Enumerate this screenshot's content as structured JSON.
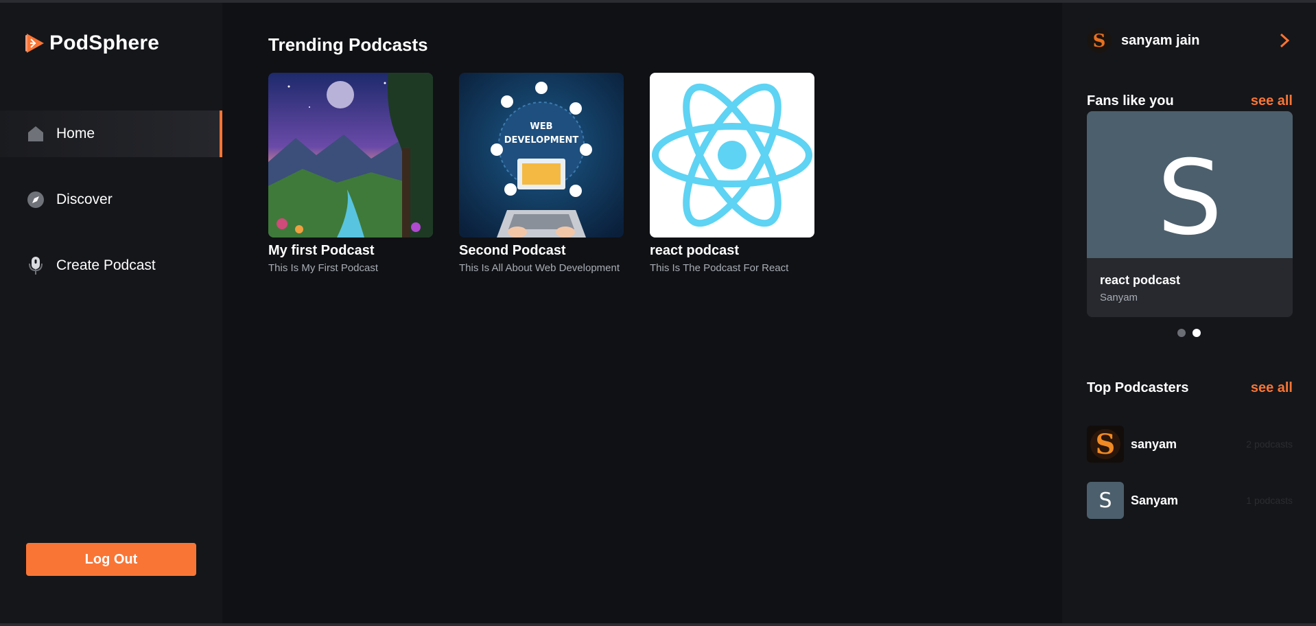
{
  "app": {
    "name": "PodSphere"
  },
  "sidebar": {
    "items": [
      {
        "label": "Home",
        "icon": "home-icon",
        "active": true
      },
      {
        "label": "Discover",
        "icon": "compass-icon",
        "active": false
      },
      {
        "label": "Create Podcast",
        "icon": "microphone-icon",
        "active": false
      }
    ],
    "logout_label": "Log Out"
  },
  "main": {
    "title": "Trending Podcasts",
    "podcasts": [
      {
        "title": "My first Podcast",
        "description": "This Is My First Podcast",
        "cover": "fantasy-landscape-image"
      },
      {
        "title": "Second Podcast",
        "description": "This Is All About Web Development",
        "cover": "web-development-image",
        "cover_text": [
          "WEB",
          "DEVELOPMENT"
        ]
      },
      {
        "title": "react podcast",
        "description": "This Is The Podcast For React",
        "cover": "react-logo-image"
      }
    ]
  },
  "rightbar": {
    "user": {
      "name": "sanyam jain"
    },
    "fans": {
      "heading": "Fans like you",
      "see_all": "see all",
      "card": {
        "letter": "S",
        "title": "react podcast",
        "author": "Sanyam"
      },
      "slides": 2,
      "active_slide": 2
    },
    "top": {
      "heading": "Top Podcasters",
      "see_all": "see all",
      "podcasters": [
        {
          "name": "sanyam",
          "count": "2 podcasts",
          "avatar": "fire-s-avatar"
        },
        {
          "name": "Sanyam",
          "count": "1 podcasts",
          "avatar_letter": "S"
        }
      ]
    }
  },
  "colors": {
    "accent": "#f97535",
    "background": "#101114",
    "sidebar": "#15161a",
    "avatar_tile": "#4c5f6c"
  }
}
